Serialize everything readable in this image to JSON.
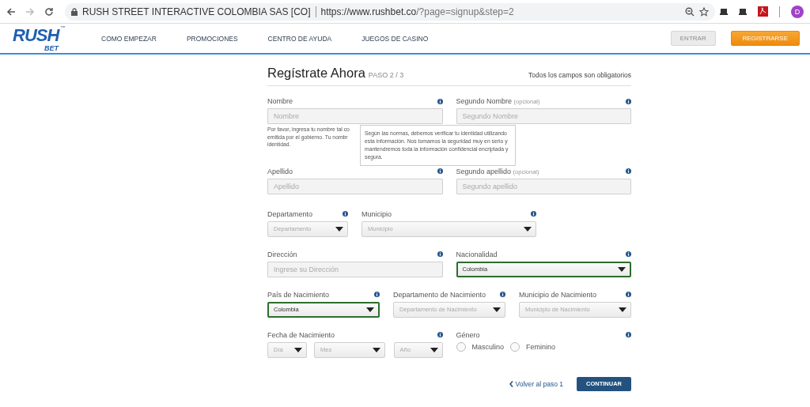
{
  "browser": {
    "site_name": "RUSH STREET INTERACTIVE COLOMBIA SAS [CO]",
    "url_main": "https://www.rushbet.co",
    "url_rest": "/?page=signup&step=2",
    "profile": "D"
  },
  "nav": {
    "logo": {
      "top": "RUSH",
      "bottom": "BET",
      "mark": "™"
    },
    "links": [
      "COMO EMPEZAR",
      "PROMOCIONES",
      "CENTRO DE AYUDA",
      "JUEGOS DE CASINO"
    ],
    "buttons": [
      {
        "label": "ENTRAR",
        "kind": "secondary"
      },
      {
        "label": "REGISTRARSE",
        "kind": "primary"
      }
    ]
  },
  "form": {
    "title": "Regístrate Ahora",
    "step": "PASO 2 / 3",
    "note": "Todos los campos son obligatorios",
    "tooltip": "Según las normas, debemos verificar tu identidad utilizando esta información. Nos tomamos la seguridad muy en serio y mantendremos toda la información confidencial encriptada y segura.",
    "rows": [
      {
        "fields": [
          {
            "kind": "text",
            "label": "Nombre",
            "placeholder": "Nombre",
            "info": true,
            "tooltip": true,
            "helper_lines": [
              "Por favor, ingresa tu nombre tal co",
              "emitida por el gobierno. Tu nombr",
              "identidad."
            ]
          },
          {
            "kind": "text",
            "label": "Segundo Nombre",
            "optional": "(opcional)",
            "placeholder": "Segundo Nombre",
            "info": true
          }
        ]
      },
      {
        "fields": [
          {
            "kind": "text",
            "label": "Apellido",
            "placeholder": "Apellido",
            "info": true
          },
          {
            "kind": "text",
            "label": "Segundo apellido",
            "optional": "(opcional)",
            "placeholder": "Segundo apellido",
            "info": true
          }
        ]
      },
      {
        "fields": [
          {
            "kind": "select",
            "label": "Departamento",
            "placeholder": "Departamento",
            "info": true,
            "valid": false
          },
          {
            "kind": "select",
            "label": "Municipio",
            "placeholder": "Municipio",
            "info": true,
            "valid": false
          }
        ]
      },
      {
        "fields": [
          {
            "kind": "text",
            "label": "Dirección",
            "placeholder": "Ingrese su Dirección",
            "info": true
          },
          {
            "kind": "select",
            "label": "Nacionalidad",
            "value": "Colombia",
            "info": true,
            "valid": true
          }
        ]
      },
      {
        "fields": [
          {
            "kind": "select",
            "label": "País de Nacimiento",
            "value": "Colombia",
            "info": true,
            "valid": true
          },
          {
            "kind": "select",
            "label": "Departamento de Nacimiento",
            "placeholder": "Departamento de Nacimiento",
            "info": true,
            "valid": false
          },
          {
            "kind": "select",
            "label": "Municipio de Nacimiento",
            "placeholder": "Municipio de Nacimiento",
            "info": true,
            "valid": false
          }
        ]
      },
      {
        "fields": [
          {
            "kind": "date",
            "label": "Fecha de Nacimiento",
            "info": true,
            "parts": [
              "Día",
              "Mes",
              "Año"
            ]
          },
          {
            "kind": "radio",
            "label": "Género",
            "info": true,
            "options": [
              {
                "label": "Masculino",
                "selected": false
              },
              {
                "label": "Feminino",
                "selected": false
              }
            ]
          }
        ]
      }
    ],
    "back_link": "Volver al paso 1",
    "continue_button": "CONTINUAR"
  }
}
